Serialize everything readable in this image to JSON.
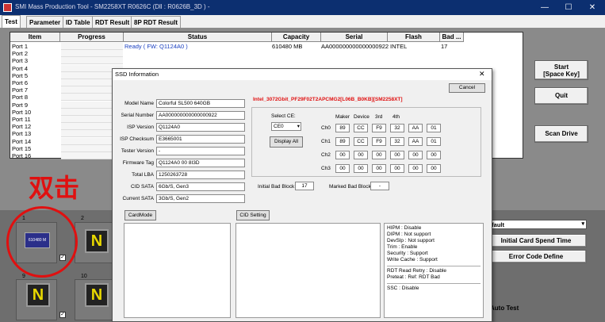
{
  "window": {
    "title": "SMI Mass Production Tool      - SM2258XT   R0626C   (Dll : R0626B_3D ) -",
    "minimize": "—",
    "maximize": "☐",
    "close": "✕"
  },
  "tabs": [
    "Test",
    "Parameter",
    "ID Table",
    "RDT Result",
    "8P RDT Result"
  ],
  "list": {
    "headers": [
      "Item",
      "Progress",
      "Status",
      "Capacity",
      "Serial",
      "Flash",
      "Bad ..."
    ],
    "ports": [
      "Port 1",
      "Port 2",
      "Port 3",
      "Port 4",
      "Port 5",
      "Port 6",
      "Port 7",
      "Port 8",
      "Port 9",
      "Port 10",
      "Port 11",
      "Port 12",
      "Port 13",
      "Port 14",
      "Port 15",
      "Port 16"
    ],
    "row1": {
      "status": "Ready ( FW: Q1124A0 )",
      "capacity": "610480 MB",
      "serial": "AA000000000000000922",
      "flash": "INTEL",
      "bad": "17"
    }
  },
  "side_buttons": {
    "start": "Start\n[Space Key]",
    "quit": "Quit",
    "scan": "Scan Drive"
  },
  "annotation": "双击",
  "bottom": {
    "select_value": "efault",
    "initial_card": "Initial Card Spend Time",
    "error_code": "Error Code Define",
    "auto_test": "Auto Test",
    "slot_labels": [
      "1",
      "2",
      "9",
      "10"
    ],
    "card_text": "610480 M",
    "n_glyph": "N"
  },
  "dialog": {
    "title": "SSD Information",
    "close": "✕",
    "cancel": "Cancel",
    "fields": [
      {
        "label": "Model Name",
        "value": "Colorful SL500 640GB"
      },
      {
        "label": "Serial Number",
        "value": "AA000000000000000922"
      },
      {
        "label": "ISP Version",
        "value": "Q1124A0"
      },
      {
        "label": "ISP Checksum",
        "value": "E3665001"
      },
      {
        "label": "Tester Version",
        "value": "-"
      },
      {
        "label": "Firmware Tag",
        "value": "Q1124A0 00  8I3D"
      },
      {
        "label": "Total LBA",
        "value": "1250263728"
      },
      {
        "label": "CID SATA",
        "value": "6Gb/S, Gen3"
      },
      {
        "label": "Current SATA",
        "value": "3Gb/S, Gen2"
      }
    ],
    "flash_info": "Intel_3072Gbit_PF29F02T2APCMG2[L06B_B0KB][SM2258XT]",
    "select_ce_label": "Select CE:",
    "select_ce_value": "CE0",
    "display_all": "Display All",
    "id_headers": [
      "Maker",
      "Device",
      "3rd",
      "4th"
    ],
    "channels": [
      {
        "name": "Ch0",
        "vals": [
          "89",
          "CC",
          "F9",
          "32",
          "AA",
          "01"
        ]
      },
      {
        "name": "Ch1",
        "vals": [
          "89",
          "CC",
          "F9",
          "32",
          "AA",
          "01"
        ]
      },
      {
        "name": "Ch2",
        "vals": [
          "00",
          "00",
          "00",
          "00",
          "00",
          "00"
        ]
      },
      {
        "name": "Ch3",
        "vals": [
          "00",
          "00",
          "00",
          "00",
          "00",
          "00"
        ]
      }
    ],
    "initial_bad_label": "Initial Bad Block",
    "initial_bad_value": "17",
    "marked_bad_label": "Marked Bad Block",
    "marked_bad_value": "-",
    "cardmode": "CardMode",
    "cid_setting": "CID Setting",
    "info_lines": [
      "HIPM : Disable",
      "DIPM : Not support",
      "DevSlp : Not support",
      "Trim : Enable",
      "Security : Support",
      "Write Cache : Support",
      "RDT Read Retry : Disable",
      "Preteat : Ref: RDT Bad",
      "SSC : Disable"
    ]
  }
}
